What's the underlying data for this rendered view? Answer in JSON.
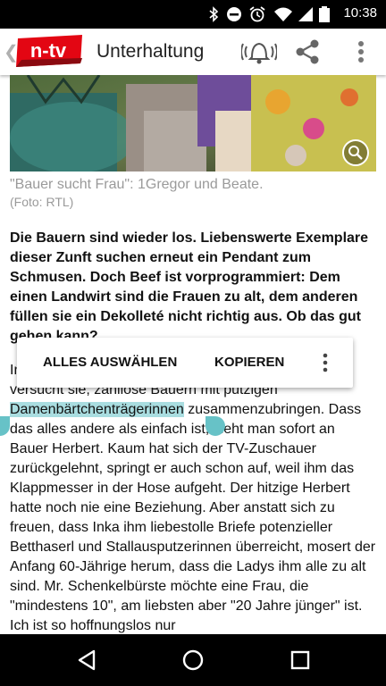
{
  "status_bar": {
    "time": "10:38",
    "icons": [
      "bluetooth-icon",
      "do-not-disturb-icon",
      "alarm-icon",
      "wifi-icon",
      "signal-icon",
      "battery-icon"
    ]
  },
  "app_bar": {
    "logo": "n-tv",
    "title": "Unterhaltung",
    "icons": [
      "back-arrow-icon",
      "bell-ringing-icon",
      "share-icon",
      "overflow-menu-icon"
    ]
  },
  "colors": {
    "logo_red": "#e30613",
    "selection": "#a9dde0",
    "handle": "#67c2c7"
  },
  "article": {
    "image_caption": "\"Bauer sucht Frau\": 1Gregor und Beate.",
    "image_credit": "(Foto: RTL)",
    "lead": "Die Bauern sind wieder los. Liebenswerte Exemplare dieser Zunft suchen erneut ein Pendant zum Schmusen. Doch Beef ist vorprogrammiert: Dem einen Landwirt sind die Frauen zu alt, dem anderen füllen sie ein Dekolleté nicht richtig aus. Ob das gut gehen kann?",
    "body_start": "In",
    "body_partial_line": "versucht sie, zahllose Bauern mit putzigen",
    "body_selected_word": "Damenbärtchenträgerinnen",
    "body_after_selection": " zusammenzubringen. Dass das alles andere als einfach ist, sieht man sofort an Bauer Herbert. Kaum hat sich der TV-Zuschauer zurückgelehnt, springt er auch schon auf, weil ihm das Klappmesser in der Hose aufgeht. Der hitzige Herbert hatte noch nie eine Beziehung. Aber anstatt sich zu freuen, dass Inka ihm liebestolle Briefe potenzieller Betthaserl und Stallausputzerinnen überreicht, mosert der Anfang 60-Jährige herum, dass die Ladys ihm alle zu alt sind. Mr. Schenkelbürste möchte eine Frau, die \"mindestens 10\", am liebsten aber \"20 Jahre jünger\" ist. Ich ist so hoffnungslos nur"
  },
  "selection_toolbar": {
    "select_all_label": "ALLES AUSWÄHLEN",
    "copy_label": "KOPIEREN",
    "more_icon": "more-vertical-icon"
  },
  "nav_bar": {
    "icons": [
      "back-triangle-icon",
      "home-circle-icon",
      "recents-square-icon"
    ]
  }
}
